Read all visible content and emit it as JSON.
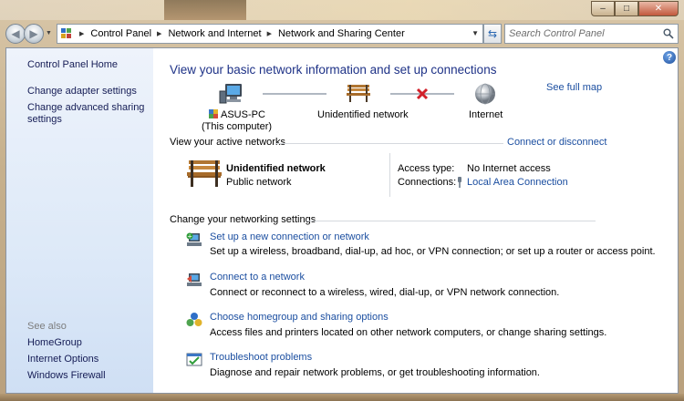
{
  "colors": {
    "link": "#1b4ea0",
    "title": "#1e3287",
    "sidebar_bg": "#dde9f8",
    "error_x": "#d1202a"
  },
  "nav": {
    "back_icon": "back-arrow-icon",
    "forward_icon": "forward-arrow-icon",
    "breadcrumbs": [
      "Control Panel",
      "Network and Internet",
      "Network and Sharing Center"
    ],
    "search_placeholder": "Search Control Panel"
  },
  "sidebar": {
    "home": "Control Panel Home",
    "links": [
      "Change adapter settings",
      "Change advanced sharing settings"
    ],
    "see_also_label": "See also",
    "see_also": [
      "HomeGroup",
      "Internet Options",
      "Windows Firewall"
    ]
  },
  "main": {
    "title": "View your basic network information and set up connections",
    "see_full_map": "See full map",
    "map": {
      "computer_name": "ASUS-PC",
      "computer_note": "(This computer)",
      "network": "Unidentified network",
      "internet": "Internet"
    },
    "active_networks": {
      "heading": "View your active networks",
      "connect_link": "Connect or disconnect",
      "network_name": "Unidentified network",
      "network_type": "Public network",
      "access_type_label": "Access type:",
      "access_type_value": "No Internet access",
      "connections_label": "Connections:",
      "connections_value": "Local Area Connection"
    },
    "settings": {
      "heading": "Change your networking settings",
      "tasks": [
        {
          "link": "Set up a new connection or network",
          "desc": "Set up a wireless, broadband, dial-up, ad hoc, or VPN connection; or set up a router or access point."
        },
        {
          "link": "Connect to a network",
          "desc": "Connect or reconnect to a wireless, wired, dial-up, or VPN network connection."
        },
        {
          "link": "Choose homegroup and sharing options",
          "desc": "Access files and printers located on other network computers, or change sharing settings."
        },
        {
          "link": "Troubleshoot problems",
          "desc": "Diagnose and repair network problems, or get troubleshooting information."
        }
      ]
    }
  }
}
